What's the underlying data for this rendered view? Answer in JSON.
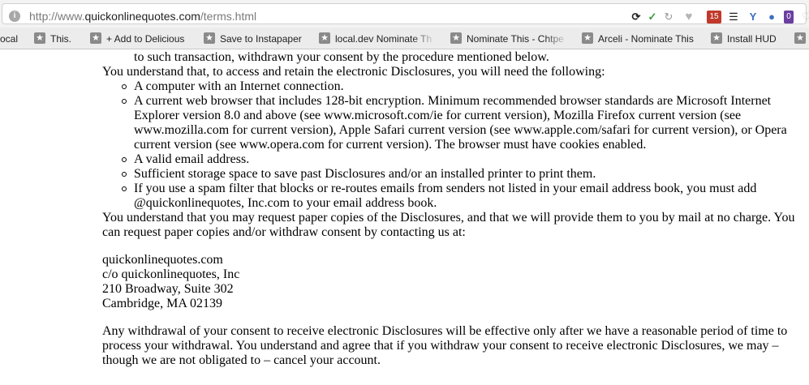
{
  "browser": {
    "url_prefix": "http://www.",
    "url_domain": "quickonlinequotes.com",
    "url_path": "/terms.html",
    "extension_badge": "15",
    "bookmarks": [
      {
        "label": "ocal"
      },
      {
        "label": "This."
      },
      {
        "label": "+ Add to Delicious"
      },
      {
        "label": "Save to Instapaper"
      },
      {
        "label": "local.dev Nominate Th"
      },
      {
        "label": "Nominate This - Chtpe"
      },
      {
        "label": "Arceli - Nominate This"
      },
      {
        "label": "Install HUD"
      }
    ]
  },
  "content": {
    "line0": "to such transaction, withdrawn your consent by the procedure mentioned below.",
    "intro": "You understand that, to access and retain the electronic Disclosures, you will need the following:",
    "bullets": {
      "b1": "A computer with an Internet connection.",
      "b2_l1": "A current web browser that includes 128-bit encryption. Minimum recommended browser standards are Microsoft Internet",
      "b2_l2": "Explorer version 8.0 and above (see www.microsoft.com/ie for current version), Mozilla Firefox current version (see",
      "b2_l3": "www.mozilla.com for current version), Apple Safari current version (see www.apple.com/safari for current version), or Opera",
      "b2_l4": "current version (see www.opera.com for current version). The browser must have cookies enabled.",
      "b3": "A valid email address.",
      "b4": "Sufficient storage space to save past Disclosures and/or an installed printer to print them.",
      "b5_l1": "If you use a spam filter that blocks or re-routes emails from senders not listed in your email address book, you must add",
      "b5_l2": "@quickonlinequotes, Inc.com to your email address book."
    },
    "paper_l1": "You understand that you may request paper copies of the Disclosures, and that we will provide them to you by mail at no charge. You",
    "paper_l2": "can request paper copies and/or withdraw consent by contacting us at:",
    "address": {
      "line1": "quickonlinequotes.com",
      "line2": "c/o quickonlinequotes, Inc",
      "line3": "210 Broadway, Suite 302",
      "line4": "Cambridge, MA 02139"
    },
    "withdraw_l1": "Any withdrawal of your consent to receive electronic Disclosures will be effective only after we have a reasonable period of time to",
    "withdraw_l2": "process your withdrawal. You understand and agree that if you withdraw your consent to receive electronic Disclosures, we may –",
    "withdraw_l3": "though we are not obligated to – cancel your account."
  }
}
